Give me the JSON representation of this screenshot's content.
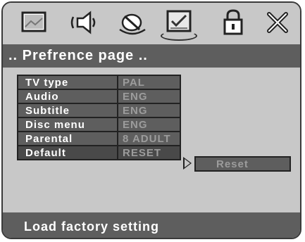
{
  "toolbar": {
    "icons": [
      {
        "name": "tv-screen-icon"
      },
      {
        "name": "speaker-icon"
      },
      {
        "name": "dolby-icon"
      },
      {
        "name": "preference-icon"
      },
      {
        "name": "lock-icon"
      },
      {
        "name": "close-icon"
      }
    ]
  },
  "header": {
    "title": ".. Prefrence  page .."
  },
  "menu": {
    "items": [
      {
        "label": "TV  type",
        "value": "PAL"
      },
      {
        "label": "Audio",
        "value": "ENG"
      },
      {
        "label": "Subtitle",
        "value": "ENG"
      },
      {
        "label": "Disc menu",
        "value": "ENG"
      },
      {
        "label": "Parental",
        "value": "8 ADULT"
      },
      {
        "label": "Default",
        "value": "RESET"
      }
    ]
  },
  "submenu": {
    "option": "Reset"
  },
  "footer": {
    "hint": "Load factory setting"
  }
}
